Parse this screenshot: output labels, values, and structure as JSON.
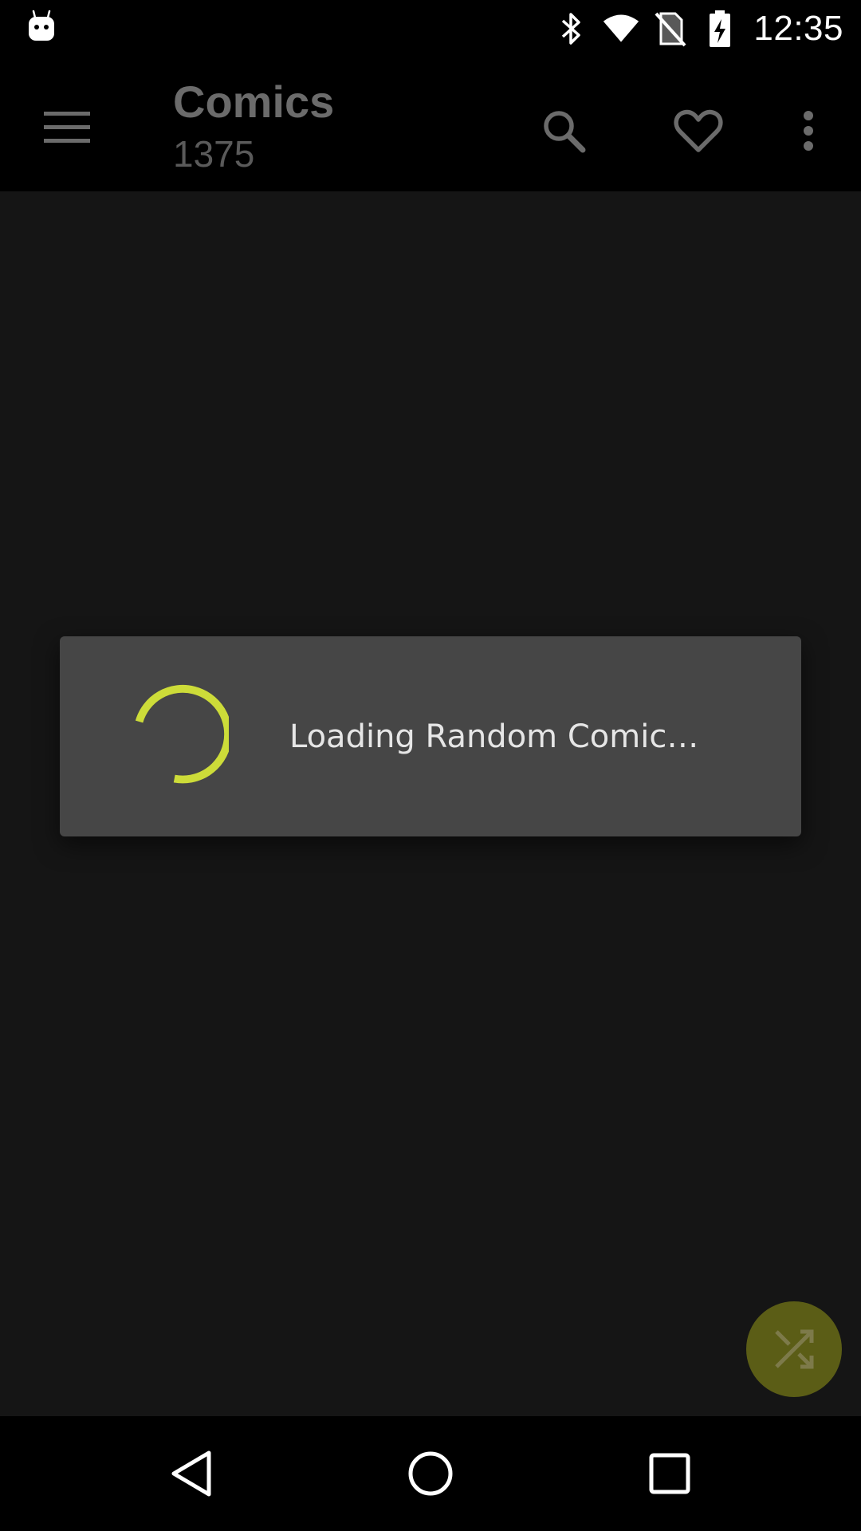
{
  "status_bar": {
    "time": "12:35",
    "icons": [
      "android-notification-icon",
      "bluetooth-icon",
      "wifi-icon",
      "no-sim-icon",
      "battery-charging-icon"
    ]
  },
  "app_bar": {
    "title": "Comics",
    "subtitle": "1375",
    "icons": [
      "menu-icon",
      "search-icon",
      "heart-icon",
      "more-vert-icon"
    ]
  },
  "dialog": {
    "message": "Loading Random Comic…",
    "spinner_color": "#cddc39"
  },
  "fab": {
    "icon": "shuffle-icon",
    "color": "#5b5d16"
  },
  "nav_bar": {
    "icons": [
      "back-icon",
      "home-icon",
      "recents-icon"
    ]
  }
}
